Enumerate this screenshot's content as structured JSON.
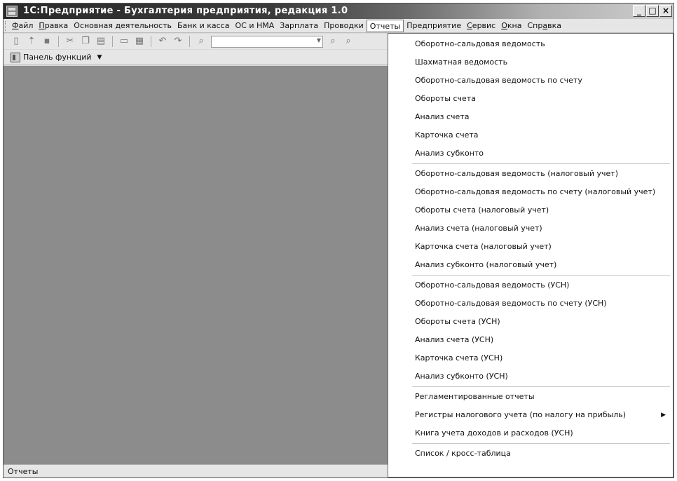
{
  "window": {
    "title": "1С:Предприятие - Бухгалтерия предприятия, редакция 1.0",
    "minimize": "_",
    "maximize": "□",
    "close": "×"
  },
  "menubar": {
    "items": [
      {
        "prefix": "",
        "accel": "Ф",
        "rest": "айл"
      },
      {
        "prefix": "",
        "accel": "П",
        "rest": "равка"
      },
      {
        "prefix": "Основная деятельность",
        "accel": "",
        "rest": ""
      },
      {
        "prefix": "Банк и касса",
        "accel": "",
        "rest": ""
      },
      {
        "prefix": "ОС и НМА",
        "accel": "",
        "rest": ""
      },
      {
        "prefix": "Зарплата",
        "accel": "",
        "rest": ""
      },
      {
        "prefix": "Проводки",
        "accel": "",
        "rest": ""
      },
      {
        "prefix": "Отчеты",
        "accel": "",
        "rest": ""
      },
      {
        "prefix": "Предприятие",
        "accel": "",
        "rest": ""
      },
      {
        "prefix": "",
        "accel": "С",
        "rest": "ервис"
      },
      {
        "prefix": "",
        "accel": "О",
        "rest": "кна"
      },
      {
        "prefix": "Спр",
        "accel": "а",
        "rest": "вка"
      }
    ]
  },
  "toolbar": {
    "icons": [
      "new-document-icon",
      "open-icon",
      "save-icon",
      "cut-icon",
      "copy-icon",
      "paste-icon",
      "print-icon",
      "preview-icon",
      "undo-icon",
      "redo-icon",
      "find-icon"
    ]
  },
  "panel": {
    "label": "Панель функций"
  },
  "status": {
    "text": "Отчеты"
  },
  "reports_menu": {
    "groups": [
      [
        "Оборотно-сальдовая ведомость",
        "Шахматная ведомость",
        "Оборотно-сальдовая ведомость по счету",
        "Обороты счета",
        "Анализ счета",
        "Карточка счета",
        "Анализ субконто"
      ],
      [
        "Оборотно-сальдовая ведомость (налоговый учет)",
        "Оборотно-сальдовая ведомость по счету (налоговый учет)",
        "Обороты счета (налоговый учет)",
        "Анализ счета (налоговый учет)",
        "Карточка счета (налоговый учет)",
        "Анализ субконто (налоговый учет)"
      ],
      [
        "Оборотно-сальдовая ведомость (УСН)",
        "Оборотно-сальдовая ведомость по счету (УСН)",
        "Обороты счета (УСН)",
        "Анализ счета (УСН)",
        "Карточка счета (УСН)",
        "Анализ субконто (УСН)"
      ],
      [
        "Регламентированные отчеты",
        "Регистры налогового учета (по налогу на прибыль)",
        "Книга учета доходов и расходов (УСН)"
      ],
      [
        "Список / кросс-таблица"
      ]
    ]
  }
}
